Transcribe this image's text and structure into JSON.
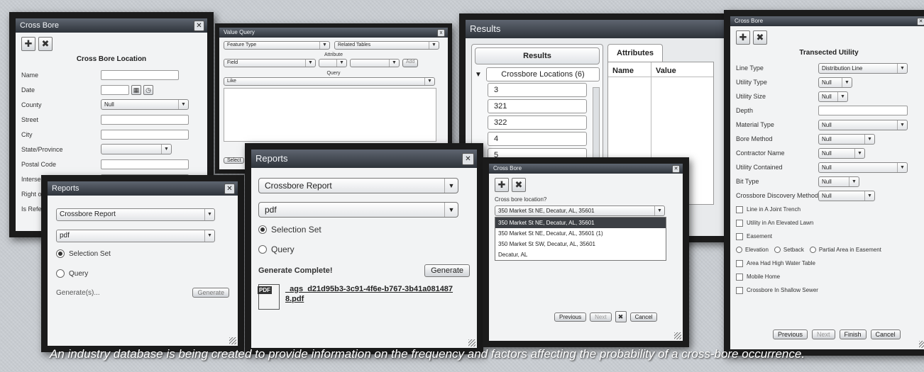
{
  "crossbore_location": {
    "title": "Cross Bore",
    "heading": "Cross Bore Location",
    "fields": [
      {
        "label": "Name",
        "value": ""
      },
      {
        "label": "Date",
        "value": ""
      },
      {
        "label": "County",
        "value": "Null"
      },
      {
        "label": "Street",
        "value": ""
      },
      {
        "label": "City",
        "value": ""
      },
      {
        "label": "State/Province",
        "value": ""
      },
      {
        "label": "Postal Code",
        "value": ""
      },
      {
        "label": "Intersecting Street Name",
        "value": ""
      }
    ],
    "partial_labels": [
      "Right of W...",
      "Is Referra..."
    ]
  },
  "query_window": {
    "title": "Value Query",
    "feature_type": "Feature Type",
    "related_tables": "Related Tables",
    "attribute_label": "Attribute",
    "field": "Field",
    "query_label": "Query",
    "operator": "Like",
    "select_btn": "Select",
    "close_icon": "x"
  },
  "results": {
    "title": "Results",
    "header": "Results",
    "group": "Crossbore Locations (6)",
    "items": [
      "3",
      "321",
      "322",
      "4",
      "5"
    ],
    "attributes_tab": "Attributes",
    "col_name": "Name",
    "col_value": "Value"
  },
  "transected_utility": {
    "title": "Cross Bore",
    "heading": "Transected Utility",
    "fields": [
      {
        "label": "Line Type",
        "value": "Distribution Line"
      },
      {
        "label": "Utility Type",
        "value": "Null"
      },
      {
        "label": "Utility Size",
        "value": "Null"
      },
      {
        "label": "Depth",
        "value": ""
      },
      {
        "label": "Material Type",
        "value": "Null"
      },
      {
        "label": "Bore Method",
        "value": "Null"
      },
      {
        "label": "Contractor Name",
        "value": "Null"
      },
      {
        "label": "Utility Contained",
        "value": "Null"
      },
      {
        "label": "Bit Type",
        "value": "Null"
      },
      {
        "label": "Crossbore Discovery Method",
        "value": "Null"
      }
    ],
    "checks": [
      "Line in A Joint Trench",
      "Utility in An Elevated Lawn",
      "Easement"
    ],
    "radios": [
      "Elevation",
      "Setback",
      "Partial Area in Easement"
    ],
    "checks2": [
      "Area Had High Water Table",
      "Mobile Home",
      "Crossbore In Shallow Sewer"
    ],
    "btns": [
      "Previous",
      "Next",
      "Finish",
      "Cancel"
    ]
  },
  "reports_small": {
    "title": "Reports",
    "report": "Crossbore Report",
    "format": "pdf",
    "selection": "Selection Set",
    "query": "Query",
    "generated": "Generate(s)...",
    "generate_btn": "Generate"
  },
  "reports_large": {
    "title": "Reports",
    "report": "Crossbore Report",
    "format": "pdf",
    "selection": "Selection Set",
    "query": "Query",
    "generate_complete": "Generate Complete!",
    "generate_btn": "Generate",
    "file_badge": "PDF",
    "file_link": "_ags_d21d95b3-3c91-4f6e-b767-3b41a0814878.pdf"
  },
  "crossbore_address": {
    "title": "Cross Bore",
    "heading": "Cross bore location?",
    "selected": "350 Market St NE, Decatur, AL, 35601",
    "options": [
      "350 Market St NE, Decatur, AL, 35601",
      "350 Market St NE, Decatur, AL, 35601 (1)",
      "350 Market St SW, Decatur, AL, 35601",
      "Decatur, AL"
    ],
    "btns": [
      "Previous",
      "Next",
      "Cancel"
    ]
  },
  "caption": "An industry database is being created to provide information on the frequency and factors affecting the probability of a cross-bore occurrence."
}
